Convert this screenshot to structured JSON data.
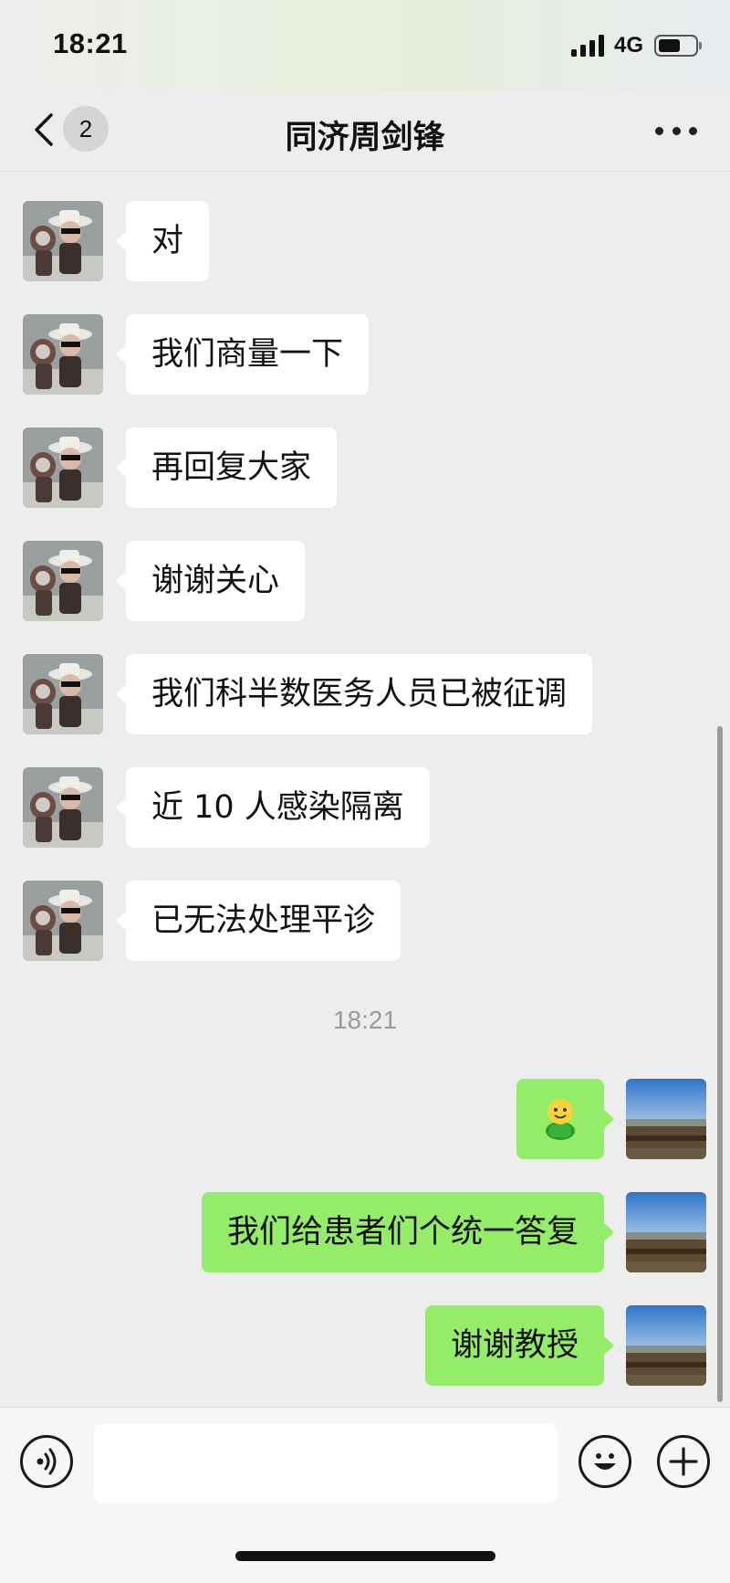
{
  "status_bar": {
    "time": "18:21",
    "network": "4G",
    "battery_level": 0.6
  },
  "header": {
    "back_label": "<",
    "unread_count": "2",
    "title": "同济周剑锋",
    "more_icon": "more-dots-icon"
  },
  "messages": [
    {
      "side": "left",
      "text": "对"
    },
    {
      "side": "left",
      "text": "我们商量一下"
    },
    {
      "side": "left",
      "text": "再回复大家"
    },
    {
      "side": "left",
      "text": "谢谢关心"
    },
    {
      "side": "left",
      "text": "我们科半数医务人员已被征调"
    },
    {
      "side": "left",
      "text": "近 10 人感染隔离"
    },
    {
      "side": "left",
      "text": "已无法处理平诊"
    },
    {
      "side": "right",
      "type": "emoji",
      "icon": "smiley-figure-icon"
    },
    {
      "side": "right",
      "text": "我们给患者们个统一答复"
    },
    {
      "side": "right",
      "text": "谢谢教授"
    }
  ],
  "timestamp": "18:21",
  "input_bar": {
    "placeholder": "",
    "voice_icon": "voice-icon",
    "emoji_icon": "emoji-icon",
    "plus_icon": "plus-icon"
  },
  "colors": {
    "sent_bubble": "#95ec69",
    "received_bubble": "#ffffff",
    "background": "#ededed"
  }
}
